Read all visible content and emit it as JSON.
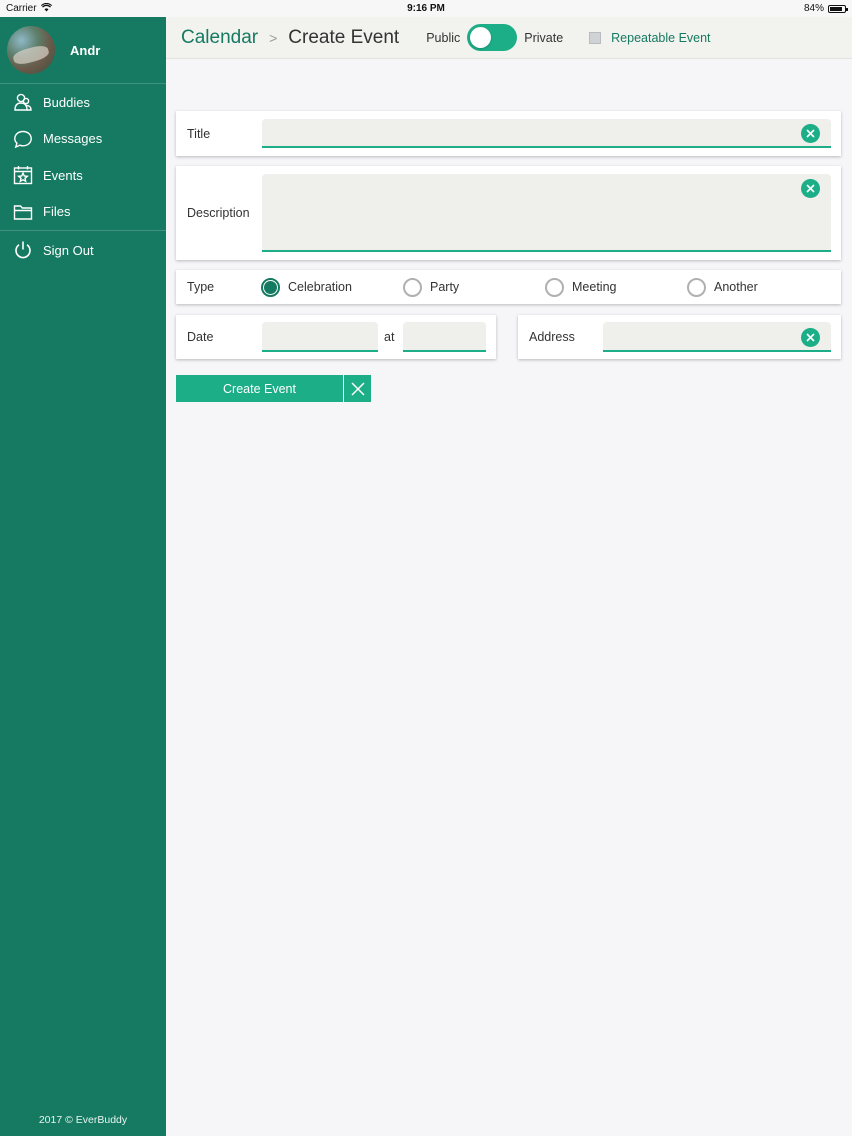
{
  "status_bar": {
    "carrier": "Carrier",
    "time": "9:16 PM",
    "battery": "84%",
    "battery_level": 0.84
  },
  "sidebar": {
    "user_name": "Andr",
    "items": [
      {
        "label": "Buddies",
        "icon": "buddies-icon"
      },
      {
        "label": "Messages",
        "icon": "chat-bubble-icon"
      },
      {
        "label": "Events",
        "icon": "star-calendar-icon"
      },
      {
        "label": "Files",
        "icon": "folder-icon"
      }
    ],
    "sign_out": {
      "label": "Sign Out",
      "icon": "power-icon"
    },
    "footer": "2017 © EverBuddy"
  },
  "header": {
    "breadcrumb_root": "Calendar",
    "breadcrumb_separator": ">",
    "breadcrumb_current": "Create Event",
    "public_label": "Public",
    "private_label": "Private",
    "repeatable_label": "Repeatable Event"
  },
  "form": {
    "title": {
      "label": "Title",
      "value": ""
    },
    "description": {
      "label": "Description",
      "value": ""
    },
    "type": {
      "label": "Type",
      "options": [
        "Celebration",
        "Party",
        "Meeting",
        "Another"
      ],
      "selected": "Celebration"
    },
    "date": {
      "label": "Date",
      "date_value": "",
      "at_label": "at",
      "time_value": ""
    },
    "address": {
      "label": "Address",
      "value": ""
    },
    "create_button": "Create Event"
  },
  "colors": {
    "sidebar": "#157a61",
    "accent": "#1cae87",
    "background": "#f6f6f8"
  }
}
